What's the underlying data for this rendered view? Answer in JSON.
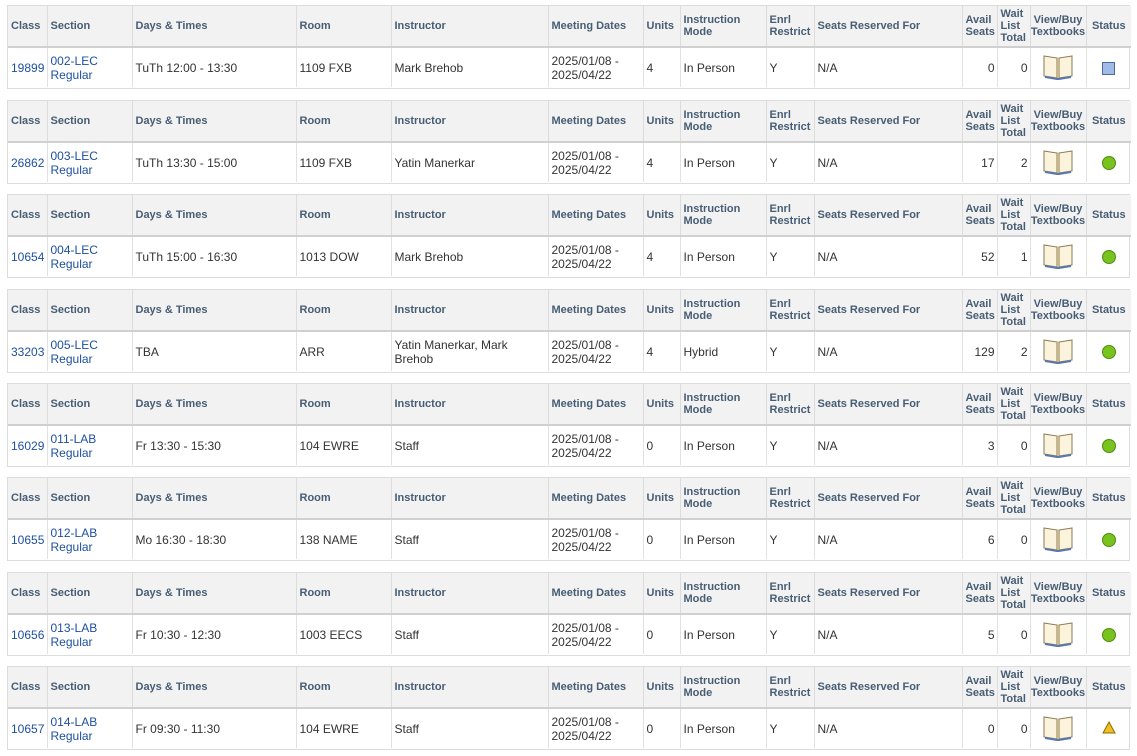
{
  "headers": {
    "class": "Class",
    "section": "Section",
    "days_times": "Days & Times",
    "room": "Room",
    "instructor": "Instructor",
    "meeting_dates": "Meeting Dates",
    "units": "Units",
    "instruction_mode": "Instruction Mode",
    "enrl_restrict": "Enrl Restrict",
    "seats_reserved": "Seats Reserved For",
    "avail_seats": "Avail Seats",
    "wait_list": "Wait List Total",
    "textbooks": "View/Buy Textbooks",
    "status": "Status"
  },
  "sections": [
    {
      "class": "19899",
      "section": "002-LEC Regular",
      "days_times": "TuTh 12:00 - 13:30",
      "room": "1109 FXB",
      "instructor": "Mark Brehob",
      "meeting_dates": "2025/01/08 - 2025/04/22",
      "units": "4",
      "mode": "In Person",
      "restrict": "Y",
      "reserved": "N/A",
      "avail": "0",
      "wait": "0",
      "status": "closed-icon"
    },
    {
      "class": "26862",
      "section": "003-LEC Regular",
      "days_times": "TuTh 13:30 - 15:00",
      "room": "1109 FXB",
      "instructor": "Yatin Manerkar",
      "meeting_dates": "2025/01/08 - 2025/04/22",
      "units": "4",
      "mode": "In Person",
      "restrict": "Y",
      "reserved": "N/A",
      "avail": "17",
      "wait": "2",
      "status": "open-icon"
    },
    {
      "class": "10654",
      "section": "004-LEC Regular",
      "days_times": "TuTh 15:00 - 16:30",
      "room": "1013 DOW",
      "instructor": "Mark Brehob",
      "meeting_dates": "2025/01/08 - 2025/04/22",
      "units": "4",
      "mode": "In Person",
      "restrict": "Y",
      "reserved": "N/A",
      "avail": "52",
      "wait": "1",
      "status": "open-icon"
    },
    {
      "class": "33203",
      "section": "005-LEC Regular",
      "days_times": "TBA",
      "room": "ARR",
      "instructor": "Yatin Manerkar, Mark Brehob",
      "meeting_dates": "2025/01/08 - 2025/04/22",
      "units": "4",
      "mode": "Hybrid",
      "restrict": "Y",
      "reserved": "N/A",
      "avail": "129",
      "wait": "2",
      "status": "open-icon"
    },
    {
      "class": "16029",
      "section": "011-LAB Regular",
      "days_times": "Fr 13:30 - 15:30",
      "room": "104 EWRE",
      "instructor": "Staff",
      "meeting_dates": "2025/01/08 - 2025/04/22",
      "units": "0",
      "mode": "In Person",
      "restrict": "Y",
      "reserved": "N/A",
      "avail": "3",
      "wait": "0",
      "status": "open-icon"
    },
    {
      "class": "10655",
      "section": "012-LAB Regular",
      "days_times": "Mo 16:30 - 18:30",
      "room": "138 NAME",
      "instructor": "Staff",
      "meeting_dates": "2025/01/08 - 2025/04/22",
      "units": "0",
      "mode": "In Person",
      "restrict": "Y",
      "reserved": "N/A",
      "avail": "6",
      "wait": "0",
      "status": "open-icon"
    },
    {
      "class": "10656",
      "section": "013-LAB Regular",
      "days_times": "Fr 10:30 - 12:30",
      "room": "1003 EECS",
      "instructor": "Staff",
      "meeting_dates": "2025/01/08 - 2025/04/22",
      "units": "0",
      "mode": "In Person",
      "restrict": "Y",
      "reserved": "N/A",
      "avail": "5",
      "wait": "0",
      "status": "open-icon"
    },
    {
      "class": "10657",
      "section": "014-LAB Regular",
      "days_times": "Fr 09:30 - 11:30",
      "room": "104 EWRE",
      "instructor": "Staff",
      "meeting_dates": "2025/01/08 - 2025/04/22",
      "units": "0",
      "mode": "In Person",
      "restrict": "Y",
      "reserved": "N/A",
      "avail": "0",
      "wait": "0",
      "status": "wait-list-icon"
    }
  ],
  "colors": {
    "open": "#78c31e",
    "closed": "#9fbbe6",
    "wait_list": "#f0c020",
    "link": "#1e50a0",
    "header_text": "#475d74"
  }
}
